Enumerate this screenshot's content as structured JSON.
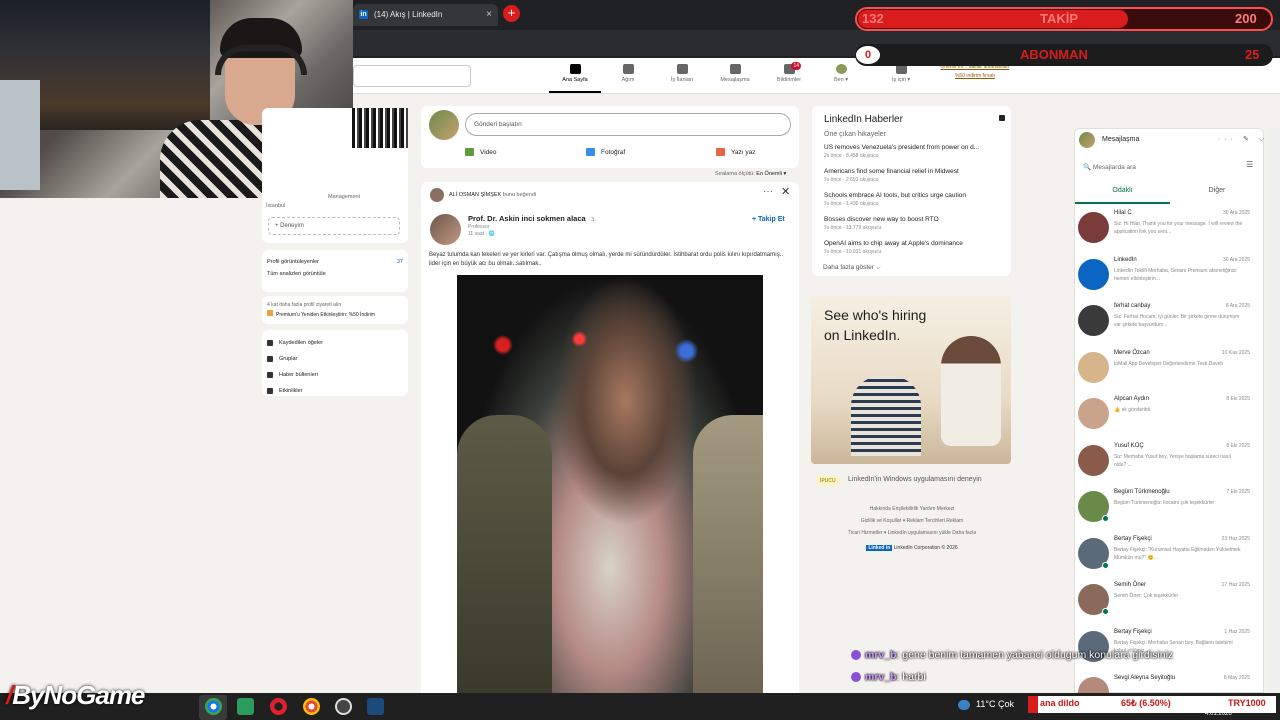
{
  "browser": {
    "tab_title": "(14) Akış | LinkedIn",
    "tab_close": "×",
    "new_tab": "+"
  },
  "nav": {
    "items": [
      {
        "label": "Ana Sayfa",
        "icon": "home-icon"
      },
      {
        "label": "Ağım",
        "icon": "network-icon"
      },
      {
        "label": "İş İlanları",
        "icon": "jobs-icon"
      },
      {
        "label": "Mesajlaşma",
        "icon": "messaging-icon"
      },
      {
        "label": "Bildirimler",
        "icon": "bell-icon",
        "badge": "14"
      },
      {
        "label": "Ben ▾",
        "icon": "avatar"
      },
      {
        "label": "İş için ▾",
        "icon": "grid-icon"
      }
    ],
    "premium_link_1": "Önemli mi... takılar anlatılanları",
    "premium_link_2": "%50 indirim fırsatı"
  },
  "left": {
    "headline_1": "Management",
    "headline_2": "İstanbul",
    "experience_btn": "+ Deneyim",
    "profile_viewers": "Profil görüntüleyenler",
    "profile_viewers_count": "37",
    "analytics": "Tüm analizleri görüntüle",
    "premium_line": "4 kat daha fazla profil ziyareti alın",
    "premium_cta": "Premium'u Yeniden Etkinleştirin: %50 İndirim",
    "links": [
      "Kaydedilen öğeler",
      "Gruplar",
      "Haber bültenleri",
      "Etkinlikler"
    ]
  },
  "compose": {
    "placeholder": "Gönderi başlatın",
    "video": "Video",
    "photo": "Fotoğraf",
    "article": "Yazı yaz",
    "sort_label": "Sıralama ölçütü:",
    "sort_value": "En Önemli ▾"
  },
  "post": {
    "liker": "ALİ OSMAN ŞİMŞEK",
    "liker_action": "bunu beğendi",
    "more": "···",
    "close": "✕",
    "author": "Prof. Dr. Askin inci sokmen alaca",
    "author_degree": "· 3.",
    "author_title": "Professor",
    "time": "11 saat · 🌐",
    "follow": "+ Takip Et",
    "text": "Beyaz tulumda kan lekeleri ve yer kirleri var. Çatışma olmuş olmalı, yerde mi süründürdüler. İstihbarat ordu polis kılını kıpırdatmamış.. lider için en büyük acı bu olmalı..satılmak.."
  },
  "news": {
    "title": "LinkedIn Haberler",
    "subtitle": "Öne çıkan hikayeler",
    "items": [
      {
        "headline": "US removes Venezuela's president from power on d...",
        "meta": "2s önce · 8.458 okuyucu"
      },
      {
        "headline": "Americans find some financial relief in Midwest",
        "meta": "7s önce · 2.691 okuyucu"
      },
      {
        "headline": "Schools embrace AI tools, but critics urge caution",
        "meta": "7s önce · 1.430 okuyucu"
      },
      {
        "headline": "Bosses discover new way to boost RTO",
        "meta": "7s önce · 13.779 okuyucu"
      },
      {
        "headline": "OpenAI aims to chip away at Apple's dominance",
        "meta": "7s önce · 10.931 okuyucu"
      }
    ],
    "more": "Daha fazla göster ⌵"
  },
  "ad": {
    "line1": "See who's hiring",
    "line2": "on LinkedIn."
  },
  "windows_app": {
    "badge": "İPUCU",
    "text": "LinkedIn'in Windows uygulamasını deneyin"
  },
  "footer": {
    "row1": "Hakkında     Erişilebilirlik     Yardım Merkezi",
    "row2": "Gizlilik ve Koşullar ▾     Reklam Tercihleri     Reklam",
    "row3": "Ticari Hizmetler ▾     LinkedIn uygulamasını yükle     Daha fazla",
    "logo": "Linked in",
    "copyright": "LinkedIn Corporation © 2026"
  },
  "messaging": {
    "title": "Mesajlaşma",
    "icons": "··· ✎ ⌵",
    "search": "🔍 Mesajlarda ara",
    "filter": "☰",
    "tab_focused": "Odaklı",
    "tab_other": "Diğer",
    "conversations": [
      {
        "name": "Hilal C",
        "date": "30 Ara 2025",
        "preview": "Siz: Hi Hilal, Thank you for your message. I will review the application link you sent...",
        "color": "#7a3b3b"
      },
      {
        "name": "LinkedIn",
        "date": "30 Ara 2025",
        "preview": "LinkedIn Teklifi Merhaba, Senani Premium aboneliğinizi hemen etkinleştirin...",
        "color": "#0a66c2"
      },
      {
        "name": "ferhat canbay",
        "date": "8 Ara 2025",
        "preview": "Siz: Ferhat Hocam, iyi günler. Bir şirkete girme durumum var şirkete başvurdum...",
        "color": "#3a3a3a"
      },
      {
        "name": "Merve Özcan",
        "date": "10 Kas 2025",
        "preview": "InMail App Developer Değerlendirme Testi Daveti",
        "color": "#d6b58a"
      },
      {
        "name": "Alpcan Aydın",
        "date": "8 Eki 2025",
        "preview": "👍 ek gönderildi.",
        "color": "#c9a38a"
      },
      {
        "name": "Yusuf KOÇ",
        "date": "8 Eki 2025",
        "preview": "Siz: Merhaba Yusuf bey, Yeniye başlama süreci nasıl oldu? ...",
        "color": "#8a5a4a"
      },
      {
        "name": "Begüm Türkmenoğlu",
        "date": "7 Eki 2025",
        "preview": "Begüm Türkmenoğlu: kocamı çok teşekkürler",
        "color": "#6a8a4a"
      },
      {
        "name": "Bertay Fişekçi",
        "date": "23 Haz 2025",
        "preview": "Bertay Fişekçi: \"Kurumsal Hayatta Eğilmeden Yükselmek Mümkün mü?\" 😊...",
        "color": "#5a6a7a"
      },
      {
        "name": "Semih Öner",
        "date": "17 Haz 2025",
        "preview": "Semih Öner: Çok teşekkürler",
        "color": "#8a6a5a"
      },
      {
        "name": "Bertay Fişekçi",
        "date": "1 Haz 2025",
        "preview": "Bertay Fişekçi: Merhaba Senan bey, Bağlantı talebimi kabul ettiğiniz...",
        "color": "#5a6a7a"
      },
      {
        "name": "Sevgi Aleyna Seyitoğlu",
        "date": "8 May 2025",
        "preview": "",
        "color": "#b58a7a"
      }
    ]
  },
  "overlay": {
    "follow_current": "132",
    "follow_label": "TAKİP",
    "follow_goal": "200",
    "sub_current": "0",
    "sub_label": "ABONMAN",
    "sub_goal": "25",
    "chat": [
      {
        "user": "mrv_b",
        "text": ": gene benim tamamen yabanci oldugum konulara girdisiniz"
      },
      {
        "user": "mrv_b",
        "text": ": harbi"
      }
    ],
    "brand": "ByNoGame"
  },
  "taskbar": {
    "weather": "11°C  Çok",
    "ticker_text": "ana dildo",
    "ticker_value": "65₺ (6.50%)",
    "ticker_currency": "TRY1000",
    "date": "4.01.2026"
  }
}
